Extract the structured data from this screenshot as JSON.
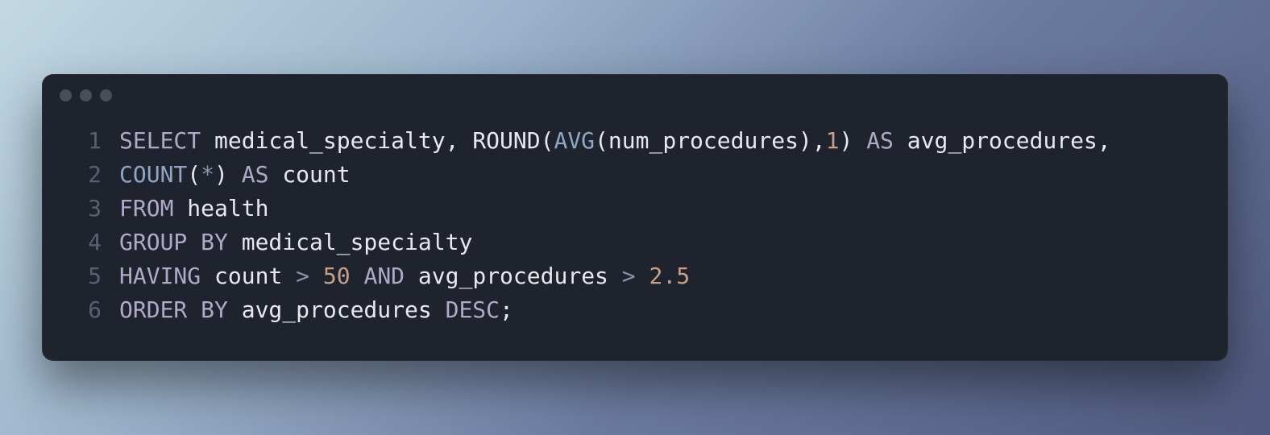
{
  "window": {
    "dots": 3
  },
  "code": {
    "language": "sql",
    "lines": [
      {
        "n": "1",
        "tokens": [
          {
            "t": "SELECT",
            "c": "kw"
          },
          {
            "t": " ",
            "c": "ident"
          },
          {
            "t": "medical_specialty,",
            "c": "ident"
          },
          {
            "t": " ",
            "c": "ident"
          },
          {
            "t": "ROUND",
            "c": "ident"
          },
          {
            "t": "(",
            "c": "ident"
          },
          {
            "t": "AVG",
            "c": "fn"
          },
          {
            "t": "(num_procedures),",
            "c": "ident"
          },
          {
            "t": "1",
            "c": "num"
          },
          {
            "t": ")",
            "c": "ident"
          },
          {
            "t": " ",
            "c": "ident"
          },
          {
            "t": "AS",
            "c": "kw"
          },
          {
            "t": " ",
            "c": "ident"
          },
          {
            "t": "avg_procedures,",
            "c": "ident"
          }
        ]
      },
      {
        "n": "2",
        "tokens": [
          {
            "t": "COUNT",
            "c": "fn"
          },
          {
            "t": "(",
            "c": "ident"
          },
          {
            "t": "*",
            "c": "star"
          },
          {
            "t": ")",
            "c": "ident"
          },
          {
            "t": " ",
            "c": "ident"
          },
          {
            "t": "AS",
            "c": "kw"
          },
          {
            "t": " ",
            "c": "ident"
          },
          {
            "t": "count",
            "c": "ident"
          }
        ]
      },
      {
        "n": "3",
        "tokens": [
          {
            "t": "FROM",
            "c": "kw"
          },
          {
            "t": " ",
            "c": "ident"
          },
          {
            "t": "health",
            "c": "ident"
          }
        ]
      },
      {
        "n": "4",
        "tokens": [
          {
            "t": "GROUP BY",
            "c": "kw"
          },
          {
            "t": " ",
            "c": "ident"
          },
          {
            "t": "medical_specialty",
            "c": "ident"
          }
        ]
      },
      {
        "n": "5",
        "tokens": [
          {
            "t": "HAVING",
            "c": "kw"
          },
          {
            "t": " ",
            "c": "ident"
          },
          {
            "t": "count",
            "c": "ident"
          },
          {
            "t": " ",
            "c": "ident"
          },
          {
            "t": ">",
            "c": "op"
          },
          {
            "t": " ",
            "c": "ident"
          },
          {
            "t": "50",
            "c": "num"
          },
          {
            "t": " ",
            "c": "ident"
          },
          {
            "t": "AND",
            "c": "kw"
          },
          {
            "t": " ",
            "c": "ident"
          },
          {
            "t": "avg_procedures",
            "c": "ident"
          },
          {
            "t": " ",
            "c": "ident"
          },
          {
            "t": ">",
            "c": "op"
          },
          {
            "t": " ",
            "c": "ident"
          },
          {
            "t": "2.5",
            "c": "num"
          }
        ]
      },
      {
        "n": "6",
        "tokens": [
          {
            "t": "ORDER BY",
            "c": "kw"
          },
          {
            "t": " ",
            "c": "ident"
          },
          {
            "t": "avg_procedures",
            "c": "ident"
          },
          {
            "t": " ",
            "c": "ident"
          },
          {
            "t": "DESC",
            "c": "kw"
          },
          {
            "t": ";",
            "c": "ident"
          }
        ]
      }
    ]
  }
}
